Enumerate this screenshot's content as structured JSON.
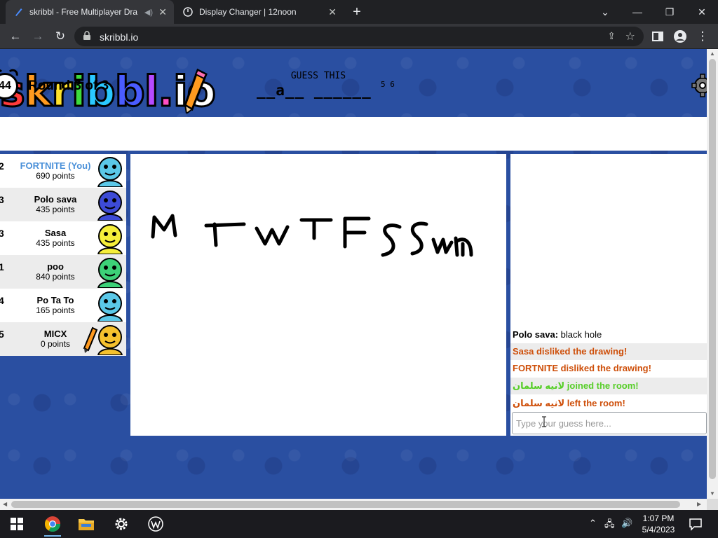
{
  "browser": {
    "tabs": [
      {
        "title": "skribbl - Free Multiplayer Dra",
        "active": true
      },
      {
        "title": "Display Changer | 12noon",
        "active": false
      }
    ],
    "url": "skribbl.io"
  },
  "game": {
    "logo_text": "skribbl.io",
    "timer": "44",
    "round": "Round 3 of 3",
    "guess_label": "GUESS THIS",
    "word_hint": "__a__ ______",
    "word_lengths": "5 6",
    "players": [
      {
        "rank": "2",
        "name": "FORTNITE (You)",
        "points": "690 points",
        "is_self": true,
        "color": "#5bc8e8"
      },
      {
        "rank": "3",
        "name": "Polo sava",
        "points": "435 points",
        "is_self": false,
        "color": "#3d4bd6"
      },
      {
        "rank": "3",
        "name": "Sasa",
        "points": "435 points",
        "is_self": false,
        "color": "#f5ee3a"
      },
      {
        "rank": "1",
        "name": "poo",
        "points": "840 points",
        "is_self": false,
        "color": "#3dd178"
      },
      {
        "rank": "4",
        "name": "Po Ta To",
        "points": "165 points",
        "is_self": false,
        "color": "#5bc8e8"
      },
      {
        "rank": "5",
        "name": "MICX",
        "points": "0 points",
        "is_self": false,
        "color": "#f5c12e"
      }
    ],
    "chat": [
      {
        "who": "Polo sava:",
        "text": "black hole"
      },
      {
        "text": "Sasa disliked the drawing!"
      },
      {
        "text": "FORTNITE disliked the drawing!"
      },
      {
        "text": "لانيه سلمان joined the room!"
      },
      {
        "text": "لانيه سلمان left the room!"
      }
    ],
    "guess_placeholder": "Type your guess here..."
  },
  "taskbar": {
    "time": "1:07 PM",
    "date": "5/4/2023"
  },
  "colors": {
    "page_bg": "#2a4fa1",
    "self_name": "#4a90d9",
    "system_red": "#ce4f0a",
    "system_green": "#56ce27"
  },
  "icons": [
    "pen-favicon",
    "power-favicon",
    "back-icon",
    "forward-icon",
    "reload-icon",
    "lock-icon",
    "share-icon",
    "star-icon",
    "sidebar-icon",
    "profile-icon",
    "menu-icon",
    "alarm-clock-icon",
    "settings-gear-icon",
    "windows-start-icon",
    "chrome-icon",
    "file-explorer-icon",
    "settings-icon",
    "wps-icon"
  ]
}
